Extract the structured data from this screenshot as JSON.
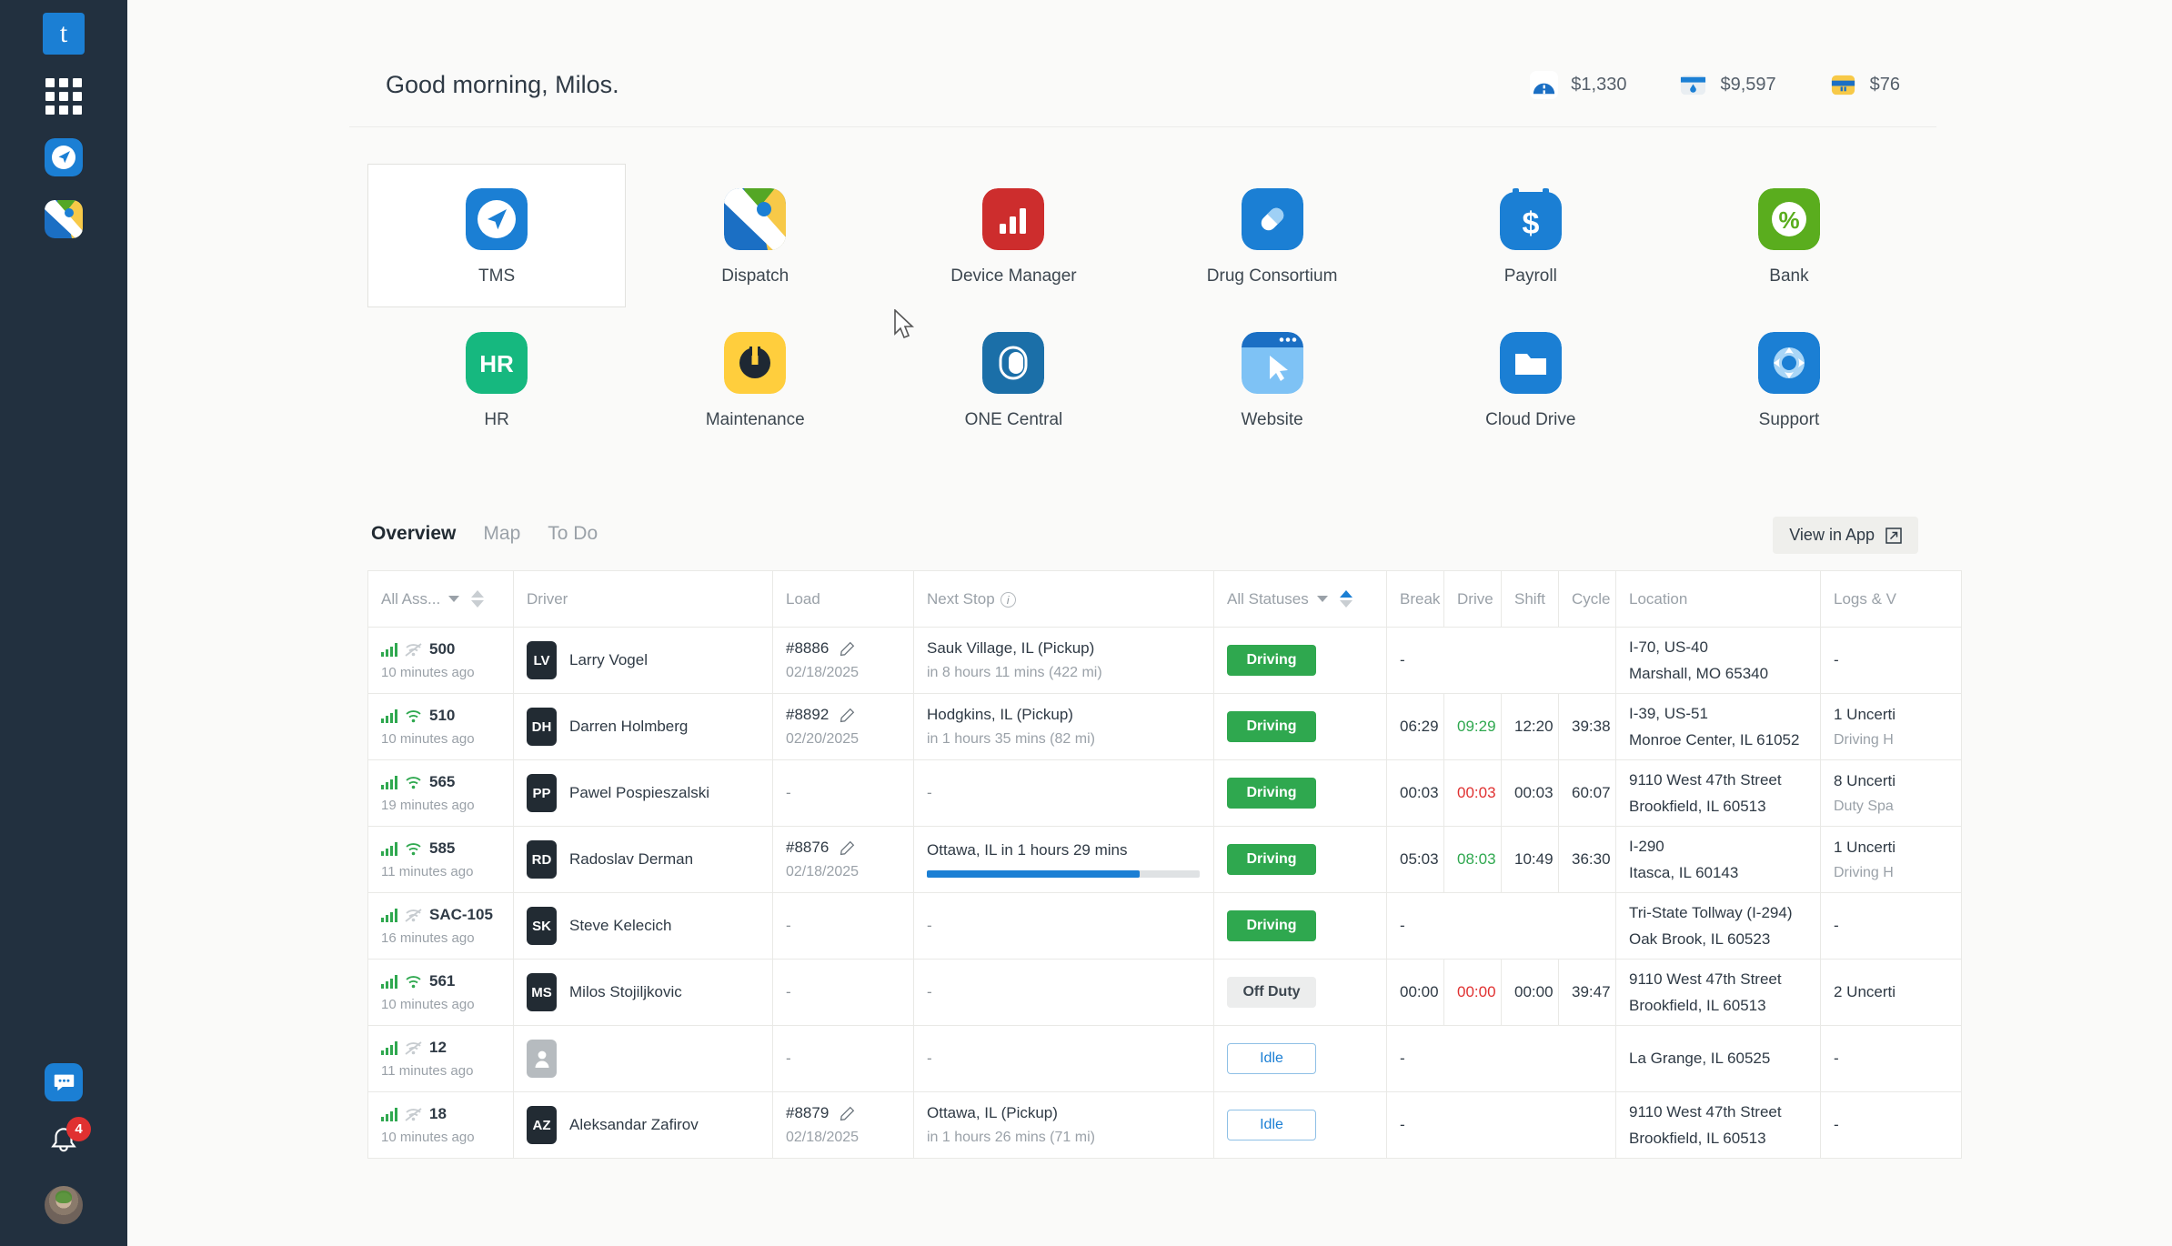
{
  "rail": {
    "logo_text": "t",
    "items": [
      {
        "name": "apps-grid-icon",
        "label": "Apps"
      },
      {
        "name": "tms-icon",
        "label": "TMS"
      },
      {
        "name": "dispatch-icon",
        "label": "Dispatch"
      }
    ],
    "chat_label": "Chat",
    "notifications_count": "4",
    "avatar_label": "Account"
  },
  "header": {
    "greeting": "Good morning, Milos.",
    "stats": [
      {
        "icon": "toll-icon",
        "value": "$1,330"
      },
      {
        "icon": "fuel-card-icon",
        "value": "$9,597"
      },
      {
        "icon": "yellow-card-icon",
        "value": "$76"
      }
    ]
  },
  "apps": {
    "row1": [
      {
        "label": "TMS",
        "icon": "tms-icon",
        "selected": true
      },
      {
        "label": "Dispatch",
        "icon": "dispatch-icon",
        "selected": false
      },
      {
        "label": "Device Manager",
        "icon": "device-manager-icon",
        "selected": false
      },
      {
        "label": "Drug Consortium",
        "icon": "drug-consortium-icon",
        "selected": false
      },
      {
        "label": "Payroll",
        "icon": "payroll-icon",
        "selected": false
      },
      {
        "label": "Bank",
        "icon": "bank-icon",
        "selected": false
      }
    ],
    "row2": [
      {
        "label": "HR",
        "icon": "hr-icon",
        "selected": false
      },
      {
        "label": "Maintenance",
        "icon": "maintenance-icon",
        "selected": false
      },
      {
        "label": "ONE Central",
        "icon": "one-central-icon",
        "selected": false
      },
      {
        "label": "Website",
        "icon": "website-icon",
        "selected": false
      },
      {
        "label": "Cloud Drive",
        "icon": "cloud-drive-icon",
        "selected": false
      },
      {
        "label": "Support",
        "icon": "support-icon",
        "selected": false
      }
    ]
  },
  "panel": {
    "tabs": [
      {
        "label": "Overview",
        "active": true
      },
      {
        "label": "Map",
        "active": false
      },
      {
        "label": "To Do",
        "active": false
      }
    ],
    "view_in_app": "View in App",
    "columns": {
      "asset": "All Ass...",
      "driver": "Driver",
      "load": "Load",
      "next_stop": "Next Stop",
      "status": "All Statuses",
      "break": "Break",
      "drive": "Drive",
      "shift": "Shift",
      "cycle": "Cycle",
      "location": "Location",
      "logs": "Logs & V"
    },
    "rows": [
      {
        "asset_id": "500",
        "asset_sub": "10 minutes ago",
        "wifi": "off",
        "initials": "LV",
        "driver": "Larry Vogel",
        "load_id": "#8886",
        "load_date": "02/18/2025",
        "next_main": "Sauk Village, IL (Pickup)",
        "next_sub": "in 8 hours 11 mins (422 mi)",
        "progress": null,
        "status": "Driving",
        "status_type": "driving",
        "break": "",
        "drive": "",
        "shift": "",
        "cycle": "",
        "hos_dash": "-",
        "loc1": "I-70, US-40",
        "loc2": "Marshall, MO 65340",
        "logs1": "-",
        "logs2": ""
      },
      {
        "asset_id": "510",
        "asset_sub": "10 minutes ago",
        "wifi": "on",
        "initials": "DH",
        "driver": "Darren Holmberg",
        "load_id": "#8892",
        "load_date": "02/20/2025",
        "next_main": "Hodgkins, IL (Pickup)",
        "next_sub": "in 1 hours 35 mins (82 mi)",
        "progress": null,
        "status": "Driving",
        "status_type": "driving",
        "break": "06:29",
        "drive": "09:29",
        "drive_color": "green",
        "shift": "12:20",
        "cycle": "39:38",
        "hos_dash": "",
        "loc1": "I-39, US-51",
        "loc2": "Monroe Center, IL 61052",
        "logs1": "1 Uncerti",
        "logs2": "Driving H"
      },
      {
        "asset_id": "565",
        "asset_sub": "19 minutes ago",
        "wifi": "on",
        "initials": "PP",
        "driver": "Pawel Pospieszalski",
        "load_id": "-",
        "load_date": "",
        "next_main": "-",
        "next_sub": "",
        "progress": null,
        "status": "Driving",
        "status_type": "driving",
        "break": "00:03",
        "drive": "00:03",
        "drive_color": "red",
        "shift": "00:03",
        "cycle": "60:07",
        "hos_dash": "",
        "loc1": "9110 West 47th Street",
        "loc2": "Brookfield, IL 60513",
        "logs1": "8 Uncerti",
        "logs2": "Duty Spa"
      },
      {
        "asset_id": "585",
        "asset_sub": "11 minutes ago",
        "wifi": "on",
        "initials": "RD",
        "driver": "Radoslav Derman",
        "load_id": "#8876",
        "load_date": "02/18/2025",
        "next_main": "Ottawa, IL in 1 hours 29 mins",
        "next_sub": "",
        "progress": 78,
        "status": "Driving",
        "status_type": "driving",
        "break": "05:03",
        "drive": "08:03",
        "drive_color": "green",
        "shift": "10:49",
        "cycle": "36:30",
        "hos_dash": "",
        "loc1": "I-290",
        "loc2": "Itasca, IL 60143",
        "logs1": "1 Uncerti",
        "logs2": "Driving H"
      },
      {
        "asset_id": "SAC-105",
        "asset_sub": "16 minutes ago",
        "wifi": "off",
        "initials": "SK",
        "driver": "Steve Kelecich",
        "load_id": "-",
        "load_date": "",
        "next_main": "-",
        "next_sub": "",
        "progress": null,
        "status": "Driving",
        "status_type": "driving",
        "break": "",
        "drive": "",
        "shift": "",
        "cycle": "",
        "hos_dash": "-",
        "loc1": "Tri-State Tollway (I-294)",
        "loc2": "Oak Brook, IL 60523",
        "logs1": "-",
        "logs2": ""
      },
      {
        "asset_id": "561",
        "asset_sub": "10 minutes ago",
        "wifi": "on",
        "initials": "MS",
        "driver": "Milos Stojiljkovic",
        "load_id": "-",
        "load_date": "",
        "next_main": "-",
        "next_sub": "",
        "progress": null,
        "status": "Off Duty",
        "status_type": "offduty",
        "break": "00:00",
        "drive": "00:00",
        "drive_color": "red",
        "shift": "00:00",
        "cycle": "39:47",
        "hos_dash": "",
        "loc1": "9110 West 47th Street",
        "loc2": "Brookfield, IL 60513",
        "logs1": "2 Uncerti",
        "logs2": ""
      },
      {
        "asset_id": "12",
        "asset_sub": "11 minutes ago",
        "wifi": "off",
        "initials": "",
        "driver": "",
        "load_id": "-",
        "load_date": "",
        "next_main": "-",
        "next_sub": "",
        "progress": null,
        "status": "Idle",
        "status_type": "idle",
        "break": "",
        "drive": "",
        "shift": "",
        "cycle": "",
        "hos_dash": "-",
        "loc1": "La Grange, IL 60525",
        "loc2": "",
        "logs1": "-",
        "logs2": ""
      },
      {
        "asset_id": "18",
        "asset_sub": "10 minutes ago",
        "wifi": "off",
        "initials": "AZ",
        "driver": "Aleksandar Zafirov",
        "load_id": "#8879",
        "load_date": "02/18/2025",
        "next_main": "Ottawa, IL (Pickup)",
        "next_sub": "in 1 hours 26 mins (71 mi)",
        "progress": null,
        "status": "Idle",
        "status_type": "idle",
        "break": "",
        "drive": "",
        "shift": "",
        "cycle": "",
        "hos_dash": "-",
        "loc1": "9110 West 47th Street",
        "loc2": "Brookfield, IL 60513",
        "logs1": "-",
        "logs2": ""
      }
    ]
  },
  "colors": {
    "accent": "#1b7fd4",
    "green": "#2fa84f",
    "red": "#e03131",
    "rail_bg": "#22303f"
  }
}
